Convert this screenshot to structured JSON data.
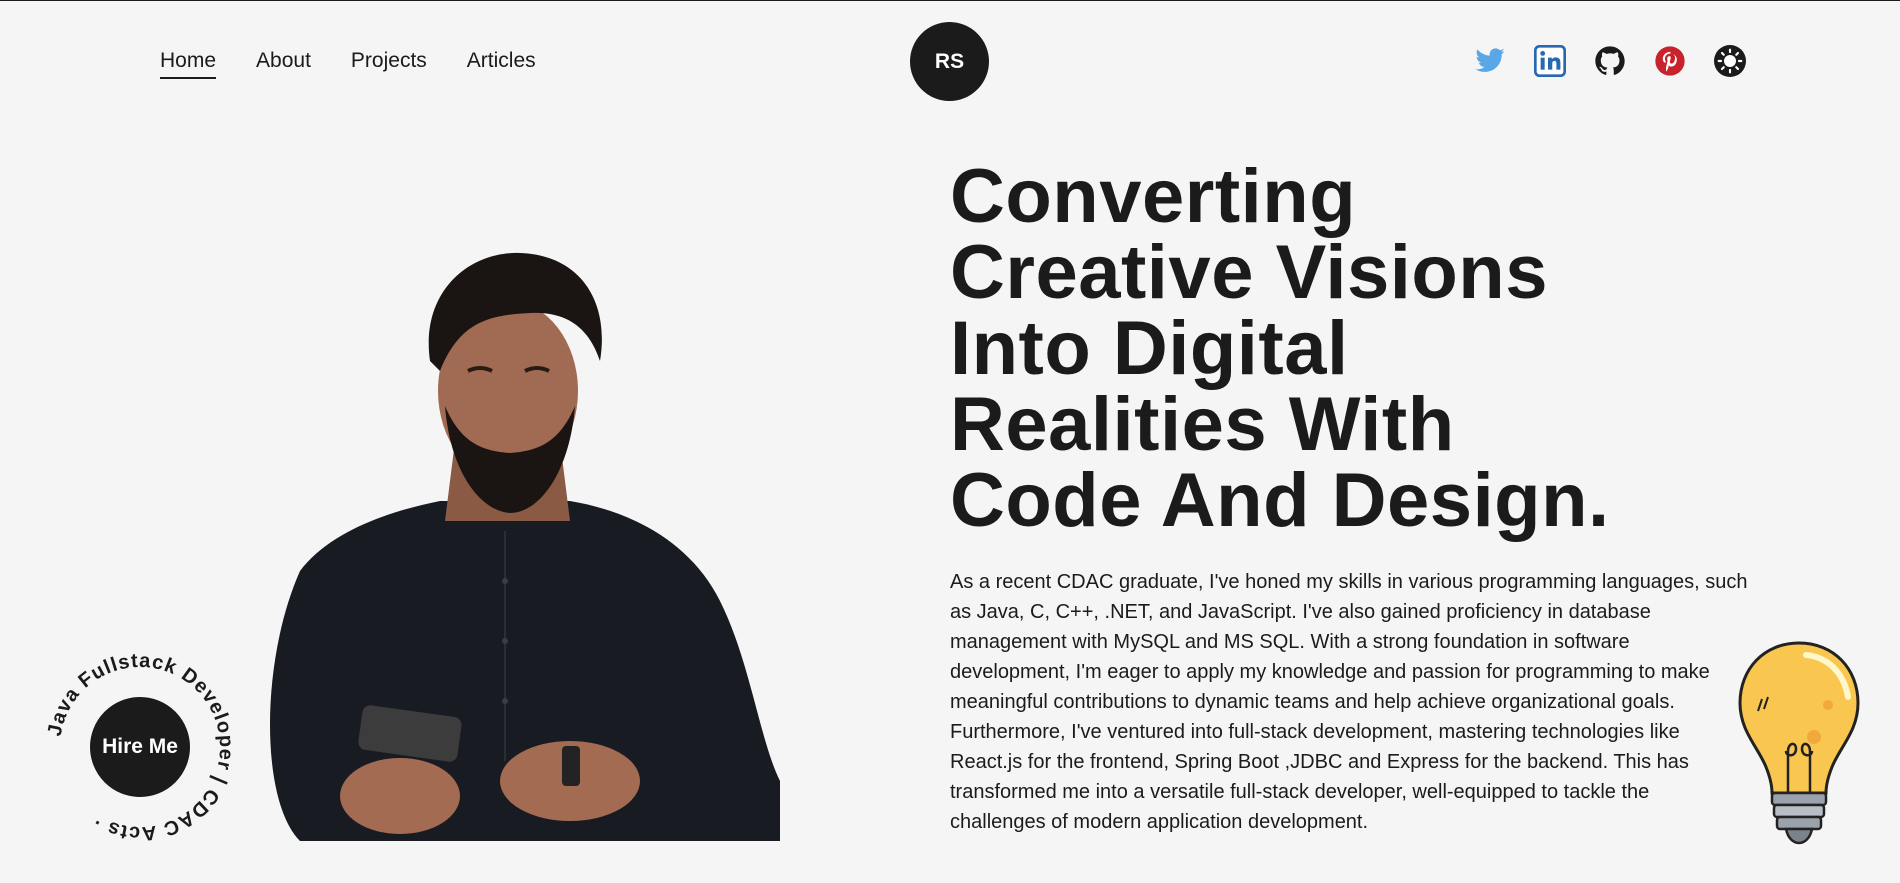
{
  "nav": {
    "links": [
      {
        "label": "Home",
        "active": true
      },
      {
        "label": "About",
        "active": false
      },
      {
        "label": "Projects",
        "active": false
      },
      {
        "label": "Articles",
        "active": false
      }
    ],
    "logo": "RS",
    "socials": [
      {
        "name": "twitter-icon",
        "color": "#1da1f2"
      },
      {
        "name": "linkedin-icon",
        "color": "#0a66c2"
      },
      {
        "name": "github-icon",
        "color": "#1b1b1b"
      },
      {
        "name": "pinterest-icon",
        "color": "#e60023"
      },
      {
        "name": "theme-toggle-sun-icon",
        "color": "#1b1b1b"
      }
    ]
  },
  "hero": {
    "headline_lines": [
      "Converting",
      "Creative Visions",
      "Into Digital",
      "Realities With",
      "Code And Design."
    ],
    "paragraph": "As a recent CDAC graduate, I've honed my skills in various programming languages, such as Java, C, C++, .NET, and JavaScript. I've also gained proficiency in database management with MySQL and MS SQL. With a strong foundation in software development, I'm eager to apply my knowledge and passion for programming to make meaningful contributions to dynamic teams and help achieve organizational goals. Furthermore, I've ventured into full-stack development, mastering technologies like React.js for the frontend, Spring Boot ,JDBC and Express for the backend. This has transformed me into a versatile full-stack developer, well-equipped to tackle the challenges of modern application development."
  },
  "hire": {
    "button_label": "Hire Me",
    "circular_text": "Java Fullstack Developer | CDAC Acts · "
  },
  "colors": {
    "background": "#f5f5f5",
    "dark": "#1b1b1b",
    "bulb_yellow": "#f9c74f"
  }
}
